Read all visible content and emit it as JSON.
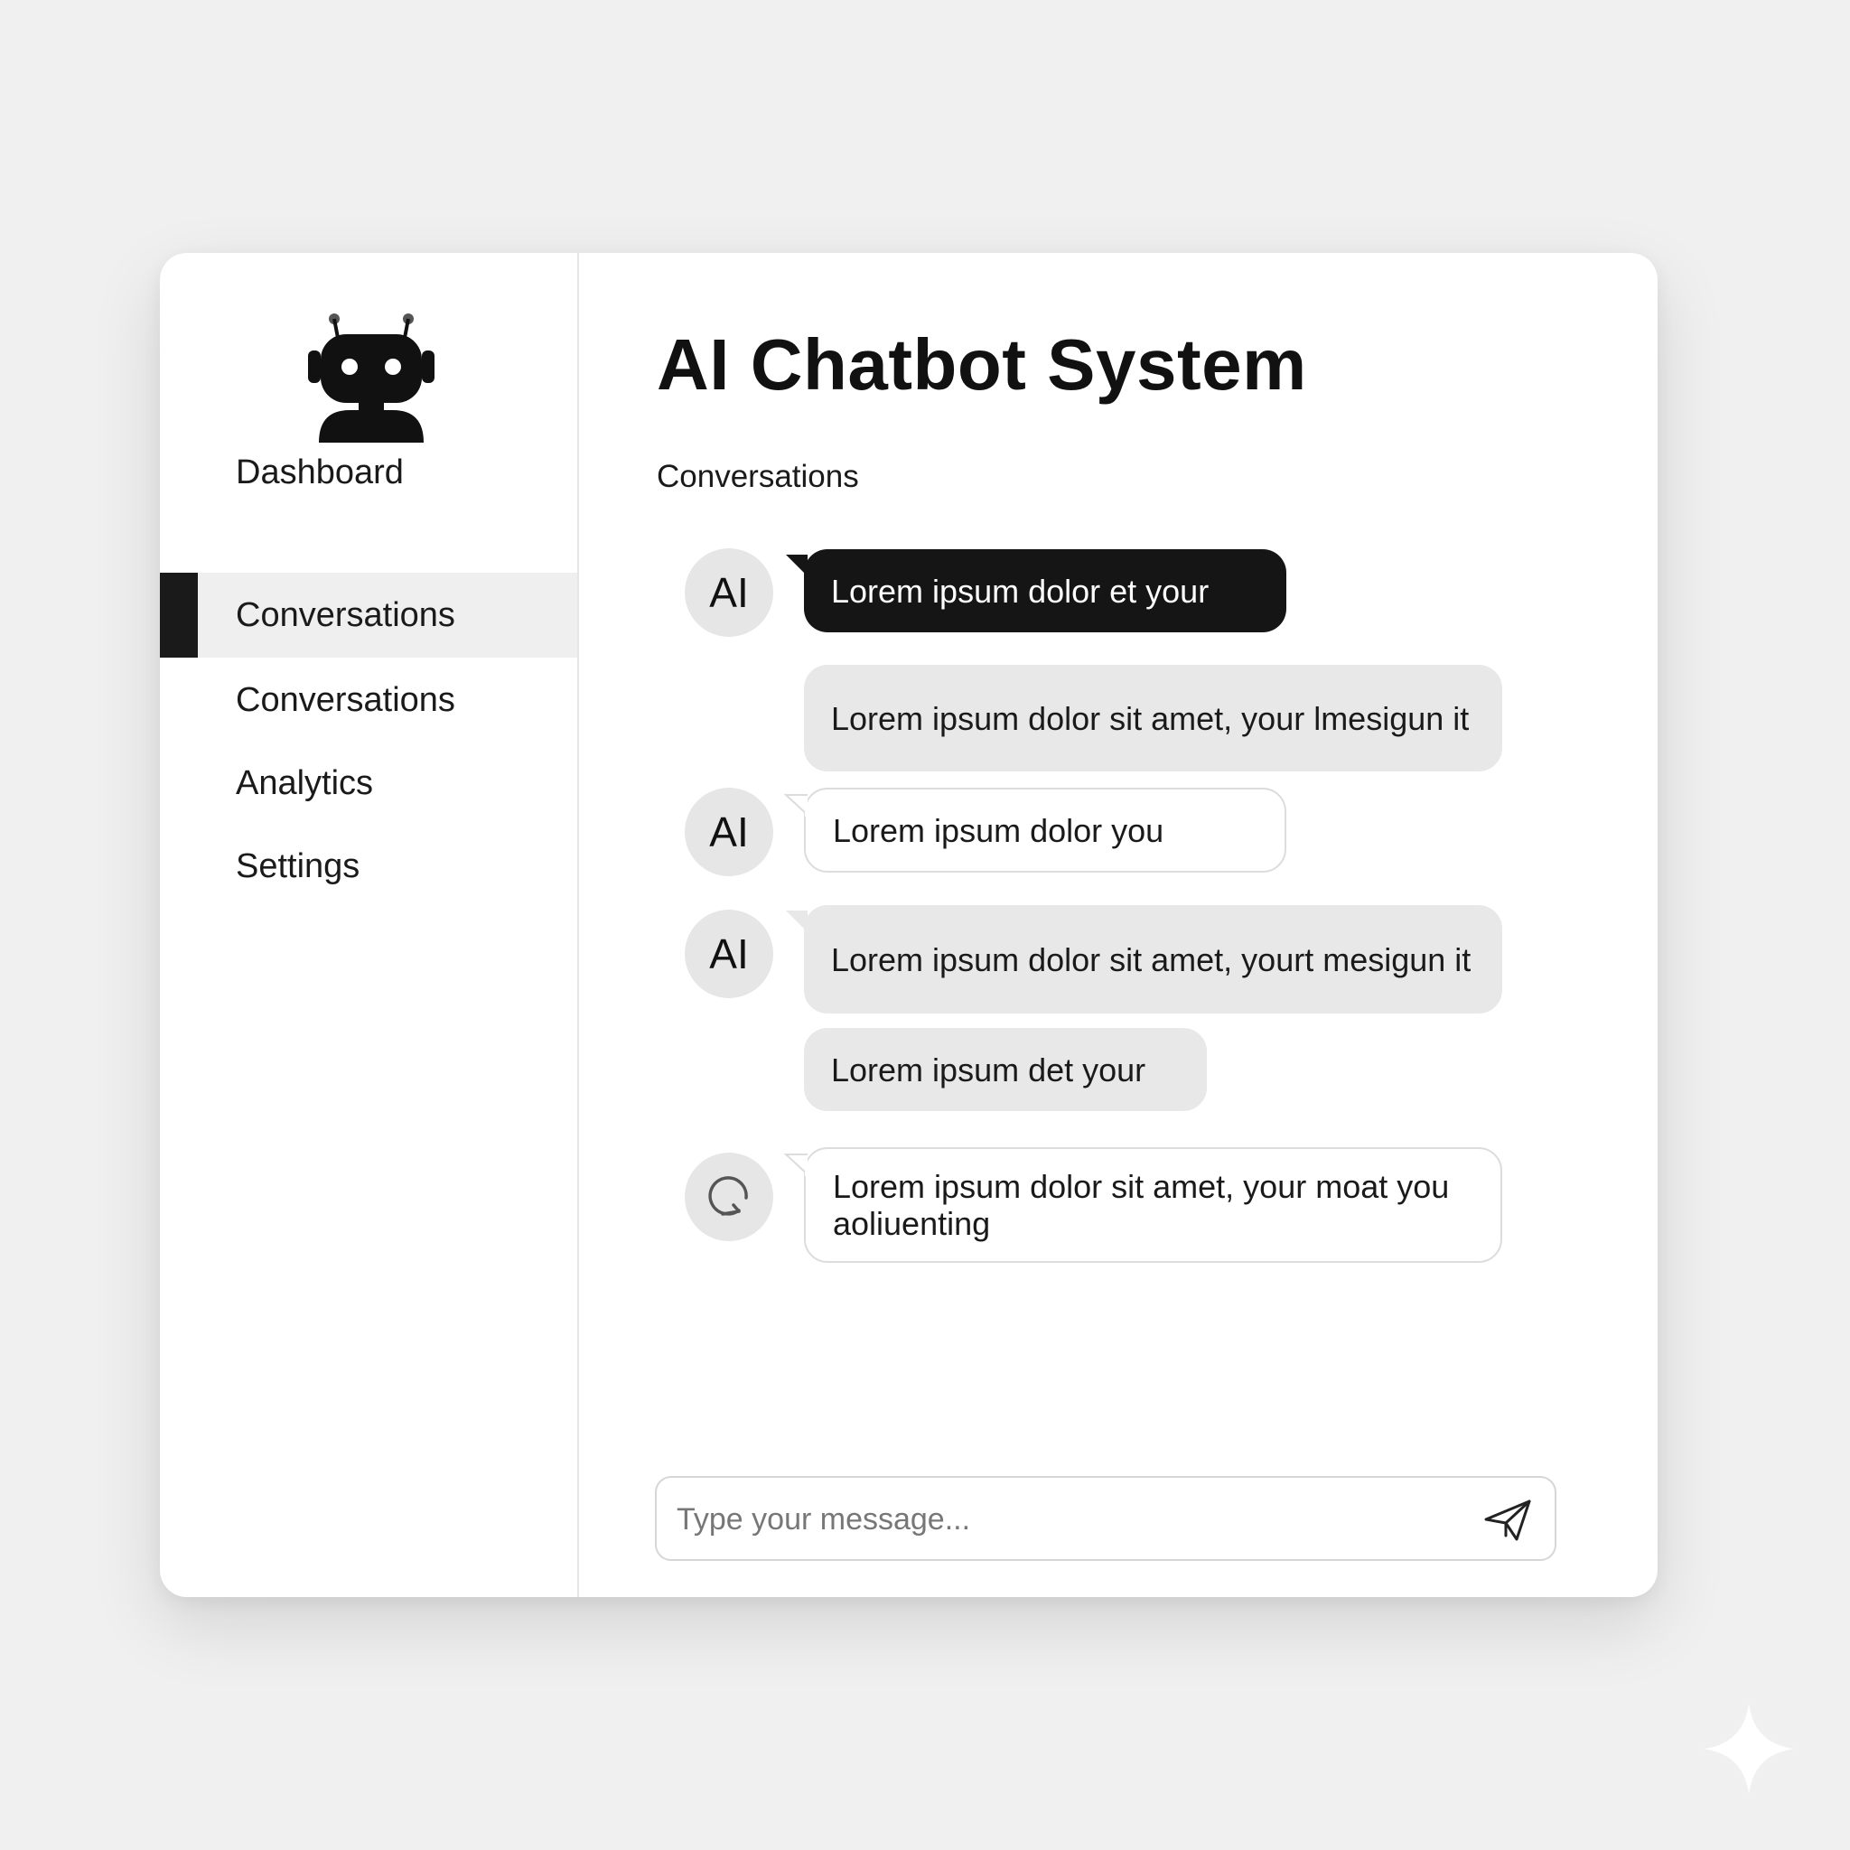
{
  "app": {
    "title": "AI Chatbot System",
    "logo_icon": "robot-icon"
  },
  "sidebar": {
    "items": [
      {
        "label": "Dashboard",
        "active": false
      },
      {
        "label": "Conversations",
        "active": true
      },
      {
        "label": "Conversations",
        "active": false
      },
      {
        "label": "Analytics",
        "active": false
      },
      {
        "label": "Settings",
        "active": false
      }
    ]
  },
  "main": {
    "section_label": "Conversations"
  },
  "messages": [
    {
      "avatar": "AI",
      "text": "Lorem ipsum dolor et your",
      "style": "dark"
    },
    {
      "avatar": "",
      "text": "Lorem ipsum dolor sit amet, your lmesigun it",
      "style": "grey"
    },
    {
      "avatar": "AI",
      "text": "Lorem ipsum dolor you",
      "style": "outline"
    },
    {
      "avatar": "AI",
      "text": "Lorem ipsum dolor sit amet, yourt mesigun it",
      "style": "grey"
    },
    {
      "avatar": "",
      "text": "Lorem ipsum det your",
      "style": "grey"
    },
    {
      "avatar_icon": "refresh-icon",
      "text": "Lorem ipsum dolor sit amet, your moat you aoliuenting",
      "style": "outline"
    }
  ],
  "composer": {
    "placeholder": "Type your message...",
    "value": "",
    "send_icon": "send-icon"
  },
  "colors": {
    "background": "#f0f0f0",
    "panel": "#ffffff",
    "accent_dark": "#151515",
    "bubble_grey": "#e8e8e8",
    "avatar_grey": "#e6e6e6"
  }
}
